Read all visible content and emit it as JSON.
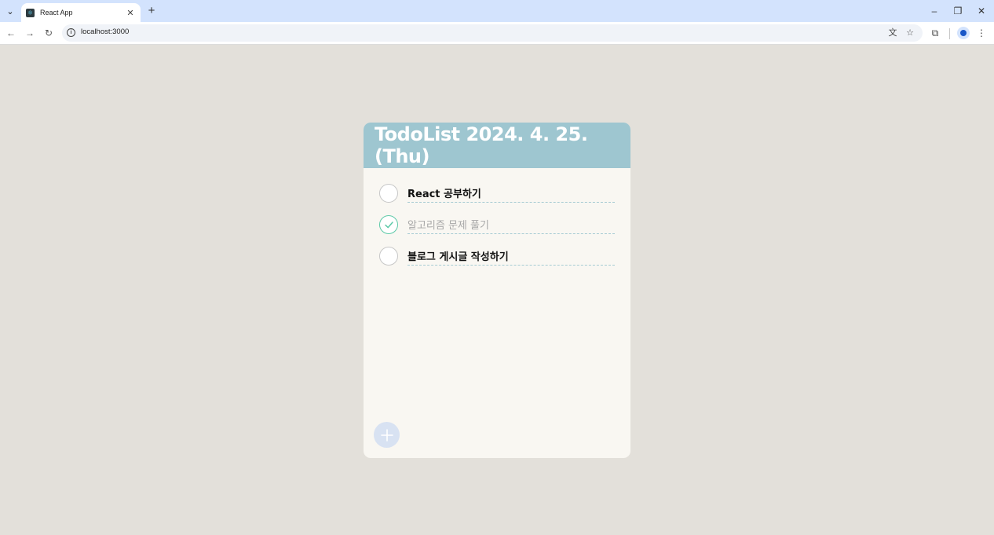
{
  "browser": {
    "tab_title": "React App",
    "tab_close": "✕",
    "new_tab": "+",
    "url": "localhost:3000",
    "window_controls": {
      "minimize": "–",
      "restore": "❐",
      "close": "✕"
    },
    "icons": [
      "tab-search-icon",
      "react-favicon",
      "back-icon",
      "forward-icon",
      "reload-icon",
      "info-icon",
      "translate-icon",
      "star-icon",
      "extensions-icon",
      "profile-icon",
      "menu-icon"
    ]
  },
  "app": {
    "title": "TodoList 2024. 4. 25. (Thu)",
    "header_color": "#9ec6d0",
    "card_color": "#f9f7f2",
    "check_color": "#5cc9a7",
    "todos": [
      {
        "text": "React 공부하기",
        "done": false
      },
      {
        "text": "알고리즘 문제 풀기",
        "done": true
      },
      {
        "text": "블로그 게시글 작성하기",
        "done": false
      }
    ]
  }
}
